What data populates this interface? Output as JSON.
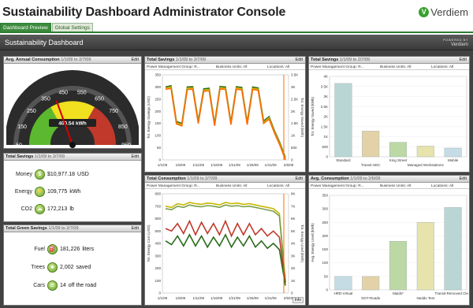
{
  "app": {
    "title": "Sustainability Dashboard Administrator Console",
    "logo_text": "Verdiem",
    "logo_mark": "V"
  },
  "tabs": [
    {
      "label": "Dashboard Preview",
      "active": true
    },
    {
      "label": "Global Settings",
      "active": false
    }
  ],
  "dashboard": {
    "title": "Sustainability Dashboard",
    "powered_by": "POWERED BY",
    "powered_brand": "Verdiem"
  },
  "panels": {
    "annual": {
      "title": "Avg. Annual Consumption",
      "date": "1/1/09 to 2/7/09",
      "edit": "Edit",
      "gauge": {
        "ticks": [
          "50",
          "150",
          "250",
          "350",
          "450",
          "550",
          "650",
          "750",
          "850",
          "950"
        ],
        "readout": "400.54 kWh",
        "value": 400.54,
        "min": 50,
        "max": 950
      }
    },
    "savings_small": {
      "title": "Total Savings",
      "date": "1/1/09 to 2/7/09",
      "edit": "Edit",
      "rows": [
        {
          "label": "Money",
          "icon": "dollar-icon",
          "glyph": "$",
          "value": "$10,977.18",
          "unit": "USD"
        },
        {
          "label": "Energy",
          "icon": "energy-icon",
          "glyph": "⚡",
          "value": "109,775",
          "unit": "kWh"
        },
        {
          "label": "CO2",
          "icon": "co2-icon",
          "glyph": "☁",
          "value": "172,213",
          "unit": "lb"
        }
      ]
    },
    "green": {
      "title": "Total Green Savings",
      "date": "1/1/09 to 2/7/09",
      "edit": "Edit",
      "rows": [
        {
          "label": "Fuel",
          "icon": "fuel-icon",
          "glyph": "⛽",
          "value": "181,226",
          "unit": "liters"
        },
        {
          "label": "Trees",
          "icon": "tree-icon",
          "glyph": "♣",
          "value": "2,002",
          "unit": "saved"
        },
        {
          "label": "Cars",
          "icon": "car-icon",
          "glyph": "◘",
          "value": "14",
          "unit": "off the road"
        }
      ]
    },
    "savings_chart": {
      "title": "Total Savings",
      "date": "1/1/09 to 2/7/09",
      "edit": "Edit",
      "filters": {
        "group": "Power Management Group: R...",
        "units": "Business Units: All",
        "locations": "Locations: All"
      }
    },
    "consumption_chart": {
      "title": "Total Consumption",
      "date": "1/1/09 to 2/7/09",
      "edit": "Edit",
      "info": "Info",
      "filters": {
        "group": "Power Management Group: R...",
        "units": "Business Units: All",
        "locations": "Locations: All"
      }
    },
    "savings_bar": {
      "title": "Total Savings",
      "date": "1/1/09 to 2/7/09",
      "edit": "Edit",
      "filters": {
        "group": "Power Management Group: R...",
        "units": "Business Units: All",
        "locations": "Locations: All"
      }
    },
    "avg_bar": {
      "title": "Avg. Consumption",
      "date": "1/1/09 to 2/6/09",
      "edit": "Edit",
      "filters": {
        "group": "Power Management Group: R...",
        "units": "Business Units: All",
        "locations": "Locations: All"
      }
    }
  },
  "chart_data": [
    {
      "type": "line",
      "x": [
        "1/1/09",
        "1/6/09",
        "1/11/09",
        "1/16/09",
        "1/21/09",
        "1/26/09",
        "1/31/09",
        "2/5/09"
      ],
      "ylabel": "Tot. Energy Savings (USD)",
      "y2label": "Tot. Energy Saved (kWh)",
      "ylim": [
        0,
        350
      ],
      "y2lim": [
        0,
        3500
      ],
      "yticks": [
        "0",
        "50",
        "100",
        "150",
        "200",
        "250",
        "300",
        "350"
      ],
      "y2ticks": [
        "0",
        "500",
        "1K",
        "1.5K",
        "2K",
        "2.5K",
        "3K",
        "3.5K"
      ],
      "series": [
        {
          "color": "#2a6a1a",
          "values": [
            300,
            305,
            158,
            150,
            300,
            301,
            160,
            292,
            295,
            150,
            302,
            300,
            155,
            301,
            298,
            155,
            300,
            296,
            160,
            178,
            120,
            70,
            10
          ]
        },
        {
          "color": "#c8b700",
          "values": [
            295,
            300,
            153,
            145,
            295,
            296,
            155,
            287,
            290,
            145,
            297,
            295,
            150,
            296,
            293,
            150,
            295,
            291,
            155,
            173,
            115,
            65,
            5
          ]
        },
        {
          "color": "#ff6a00",
          "values": [
            290,
            295,
            148,
            140,
            290,
            291,
            150,
            282,
            285,
            140,
            292,
            290,
            145,
            291,
            288,
            145,
            290,
            286,
            150,
            168,
            110,
            60,
            0
          ]
        }
      ]
    },
    {
      "type": "line",
      "x": [
        "1/1/09",
        "1/6/09",
        "1/11/09",
        "1/16/09",
        "1/21/09",
        "1/26/09",
        "1/31/09",
        "2/5/09"
      ],
      "ylabel": "Tot. Energy Cost (USD)",
      "y2label": "Tot. Energy Used (kWh)",
      "ylim": [
        0,
        800
      ],
      "y2lim": [
        0,
        8000
      ],
      "yticks": [
        "0",
        "100",
        "200",
        "300",
        "400",
        "500",
        "600",
        "700",
        "800"
      ],
      "y2ticks": [
        "0",
        "1K",
        "2K",
        "3K",
        "4K",
        "5K",
        "6K",
        "7K",
        "8K"
      ],
      "series": [
        {
          "color": "#c8b700",
          "values": [
            700,
            690,
            720,
            710,
            730,
            720,
            715,
            725,
            720,
            710,
            730,
            720,
            725,
            715,
            720,
            710,
            700,
            690,
            680,
            640,
            100
          ]
        },
        {
          "color": "#7a9e4a",
          "values": [
            680,
            672,
            700,
            690,
            710,
            700,
            695,
            705,
            700,
            690,
            710,
            700,
            705,
            695,
            700,
            690,
            680,
            670,
            660,
            620,
            90
          ]
        },
        {
          "color": "#c0392b",
          "values": [
            520,
            500,
            560,
            480,
            580,
            470,
            570,
            480,
            560,
            470,
            580,
            460,
            560,
            470,
            560,
            470,
            520,
            460,
            500,
            450,
            80
          ]
        },
        {
          "color": "#2a6a1a",
          "values": [
            420,
            390,
            460,
            380,
            470,
            380,
            460,
            370,
            450,
            380,
            470,
            370,
            450,
            380,
            460,
            370,
            420,
            360,
            400,
            350,
            60
          ]
        }
      ]
    },
    {
      "type": "bar",
      "categories": [
        "Standard",
        "Transit-SDC",
        "King Street",
        "Managed Workstations",
        "Mobile"
      ],
      "values": [
        3650,
        1280,
        720,
        530,
        430
      ],
      "colors": [
        "#b9d6d4",
        "#e3d2a8",
        "#bcd9a5",
        "#e6e3ac",
        "#c5dce5"
      ],
      "ylabel": "Tot. Energy Saved (kWh)",
      "ylim": [
        0,
        4000
      ],
      "yticks": [
        "0",
        "500",
        "1K",
        "1.5K",
        "2K",
        "2.5K",
        "3K",
        "3.5K",
        "4K"
      ]
    },
    {
      "type": "bar",
      "categories": [
        "HRD-Virtual",
        "DOT-Roads",
        "Maids*",
        "Neddo Test",
        "Transit-Removed Cle..."
      ],
      "values": [
        50,
        50,
        180,
        250,
        305
      ],
      "colors": [
        "#c5dce5",
        "#e3d2a8",
        "#bcd9a5",
        "#e6e3ac",
        "#b9d6d4"
      ],
      "ylabel": "Avg. Energy Used (kWh)",
      "ylim": [
        0,
        350
      ],
      "yticks": [
        "0",
        "50",
        "100",
        "150",
        "200",
        "250",
        "300",
        "350"
      ]
    }
  ]
}
